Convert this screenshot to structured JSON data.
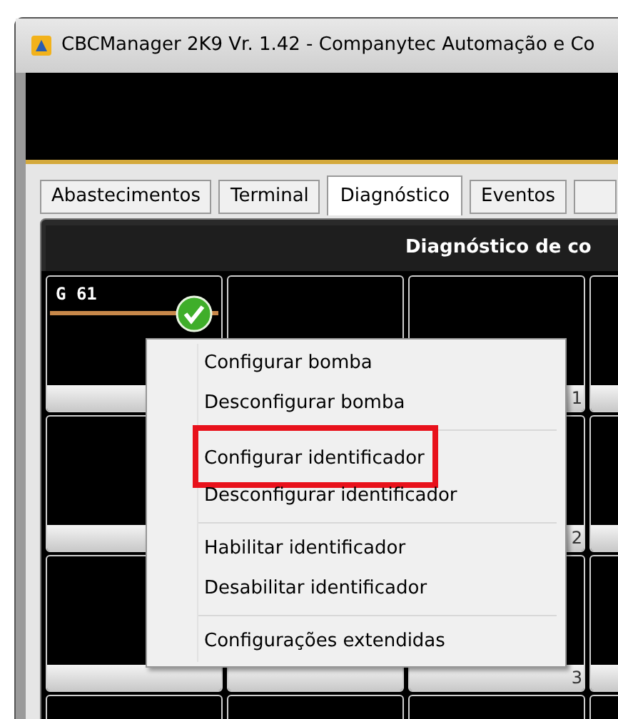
{
  "window": {
    "title": "CBCManager 2K9 Vr. 1.42 - Companytec Automação e Co"
  },
  "tabs": [
    {
      "label": "Abastecimentos",
      "selected": false
    },
    {
      "label": "Terminal",
      "selected": false
    },
    {
      "label": "Diagnóstico",
      "selected": true
    },
    {
      "label": "Eventos",
      "selected": false
    }
  ],
  "panel": {
    "title": "Diagnóstico de co",
    "rows": [
      [
        {
          "label": "G 61",
          "ok": true
        },
        {},
        {
          "footer": "1"
        },
        {}
      ],
      [
        {},
        {},
        {
          "footer": "2"
        },
        {}
      ],
      [
        {},
        {},
        {
          "footer": "3"
        },
        {}
      ],
      [
        {},
        {},
        {},
        {}
      ]
    ]
  },
  "context_menu": {
    "items": [
      {
        "label": "Configurar bomba",
        "highlighted": false
      },
      {
        "label": "Desconfigurar bomba",
        "highlighted": false,
        "separator_after": true
      },
      {
        "label": "Configurar identificador",
        "highlighted": true
      },
      {
        "label": "Desconfigurar identificador",
        "highlighted": false,
        "separator_after": true
      },
      {
        "label": "Habilitar identificador",
        "highlighted": false
      },
      {
        "label": "Desabilitar identificador",
        "highlighted": false,
        "separator_after": true
      },
      {
        "label": "Configurações extendidas",
        "highlighted": false
      }
    ]
  }
}
